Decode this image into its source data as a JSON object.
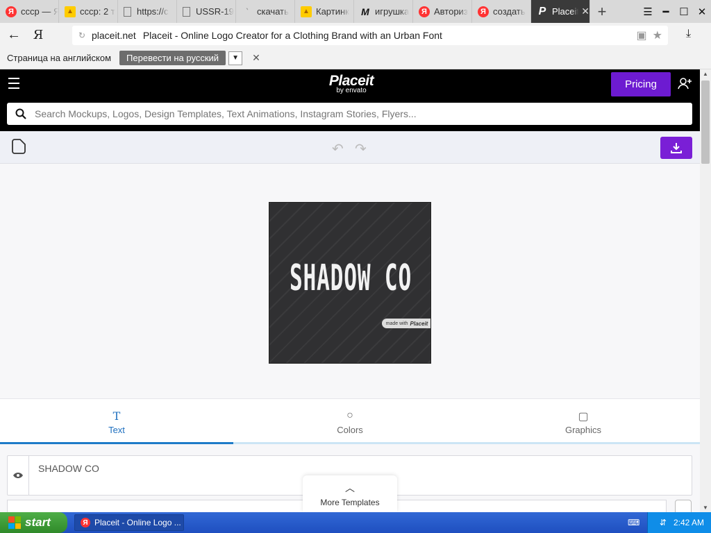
{
  "browser": {
    "tabs": [
      {
        "label": "ссср — Я",
        "icon": "yandex-icon"
      },
      {
        "label": "ссср: 2 т",
        "icon": "image-icon"
      },
      {
        "label": "https://c",
        "icon": "document-icon"
      },
      {
        "label": "USSR-19",
        "icon": "document-icon"
      },
      {
        "label": "скачать",
        "icon": "loading-icon"
      },
      {
        "label": "Картинк",
        "icon": "image-icon"
      },
      {
        "label": "игрушка",
        "icon": "m-logo-icon"
      },
      {
        "label": "Авториз",
        "icon": "yandex-icon"
      },
      {
        "label": "создать",
        "icon": "yandex-icon"
      },
      {
        "label": "Placeit",
        "icon": "placeit-icon"
      }
    ],
    "address": {
      "domain": "placeit.net",
      "page_title": "Placeit - Online Logo Creator for a Clothing Brand with an Urban Font",
      "yandex_button": "Я"
    },
    "translate_bar": {
      "message": "Страница на английском",
      "button": "Перевести на русский"
    }
  },
  "site": {
    "brand": {
      "name": "Placeit",
      "byline": "by envato"
    },
    "pricing_label": "Pricing",
    "search_placeholder": "Search Mockups, Logos, Design Templates, Text Animations, Instagram Stories, Flyers..."
  },
  "editor": {
    "logo_text": "SHADOW CO",
    "watermark": {
      "prefix": "made with",
      "brand": "Placeit"
    },
    "tabs": [
      {
        "label": "Text",
        "active": true
      },
      {
        "label": "Colors",
        "active": false
      },
      {
        "label": "Graphics",
        "active": false
      }
    ],
    "text_field_value": "SHADOW CO",
    "more_templates_label": "More Templates"
  },
  "taskbar": {
    "start_label": "start",
    "window_item": "Placeit - Online Logo ...",
    "clock": "2:42 AM"
  },
  "colors": {
    "pricing_bg": "#6d1bd1",
    "download_bg": "#7a1fd6",
    "active_tab": "#1e7bc8"
  }
}
